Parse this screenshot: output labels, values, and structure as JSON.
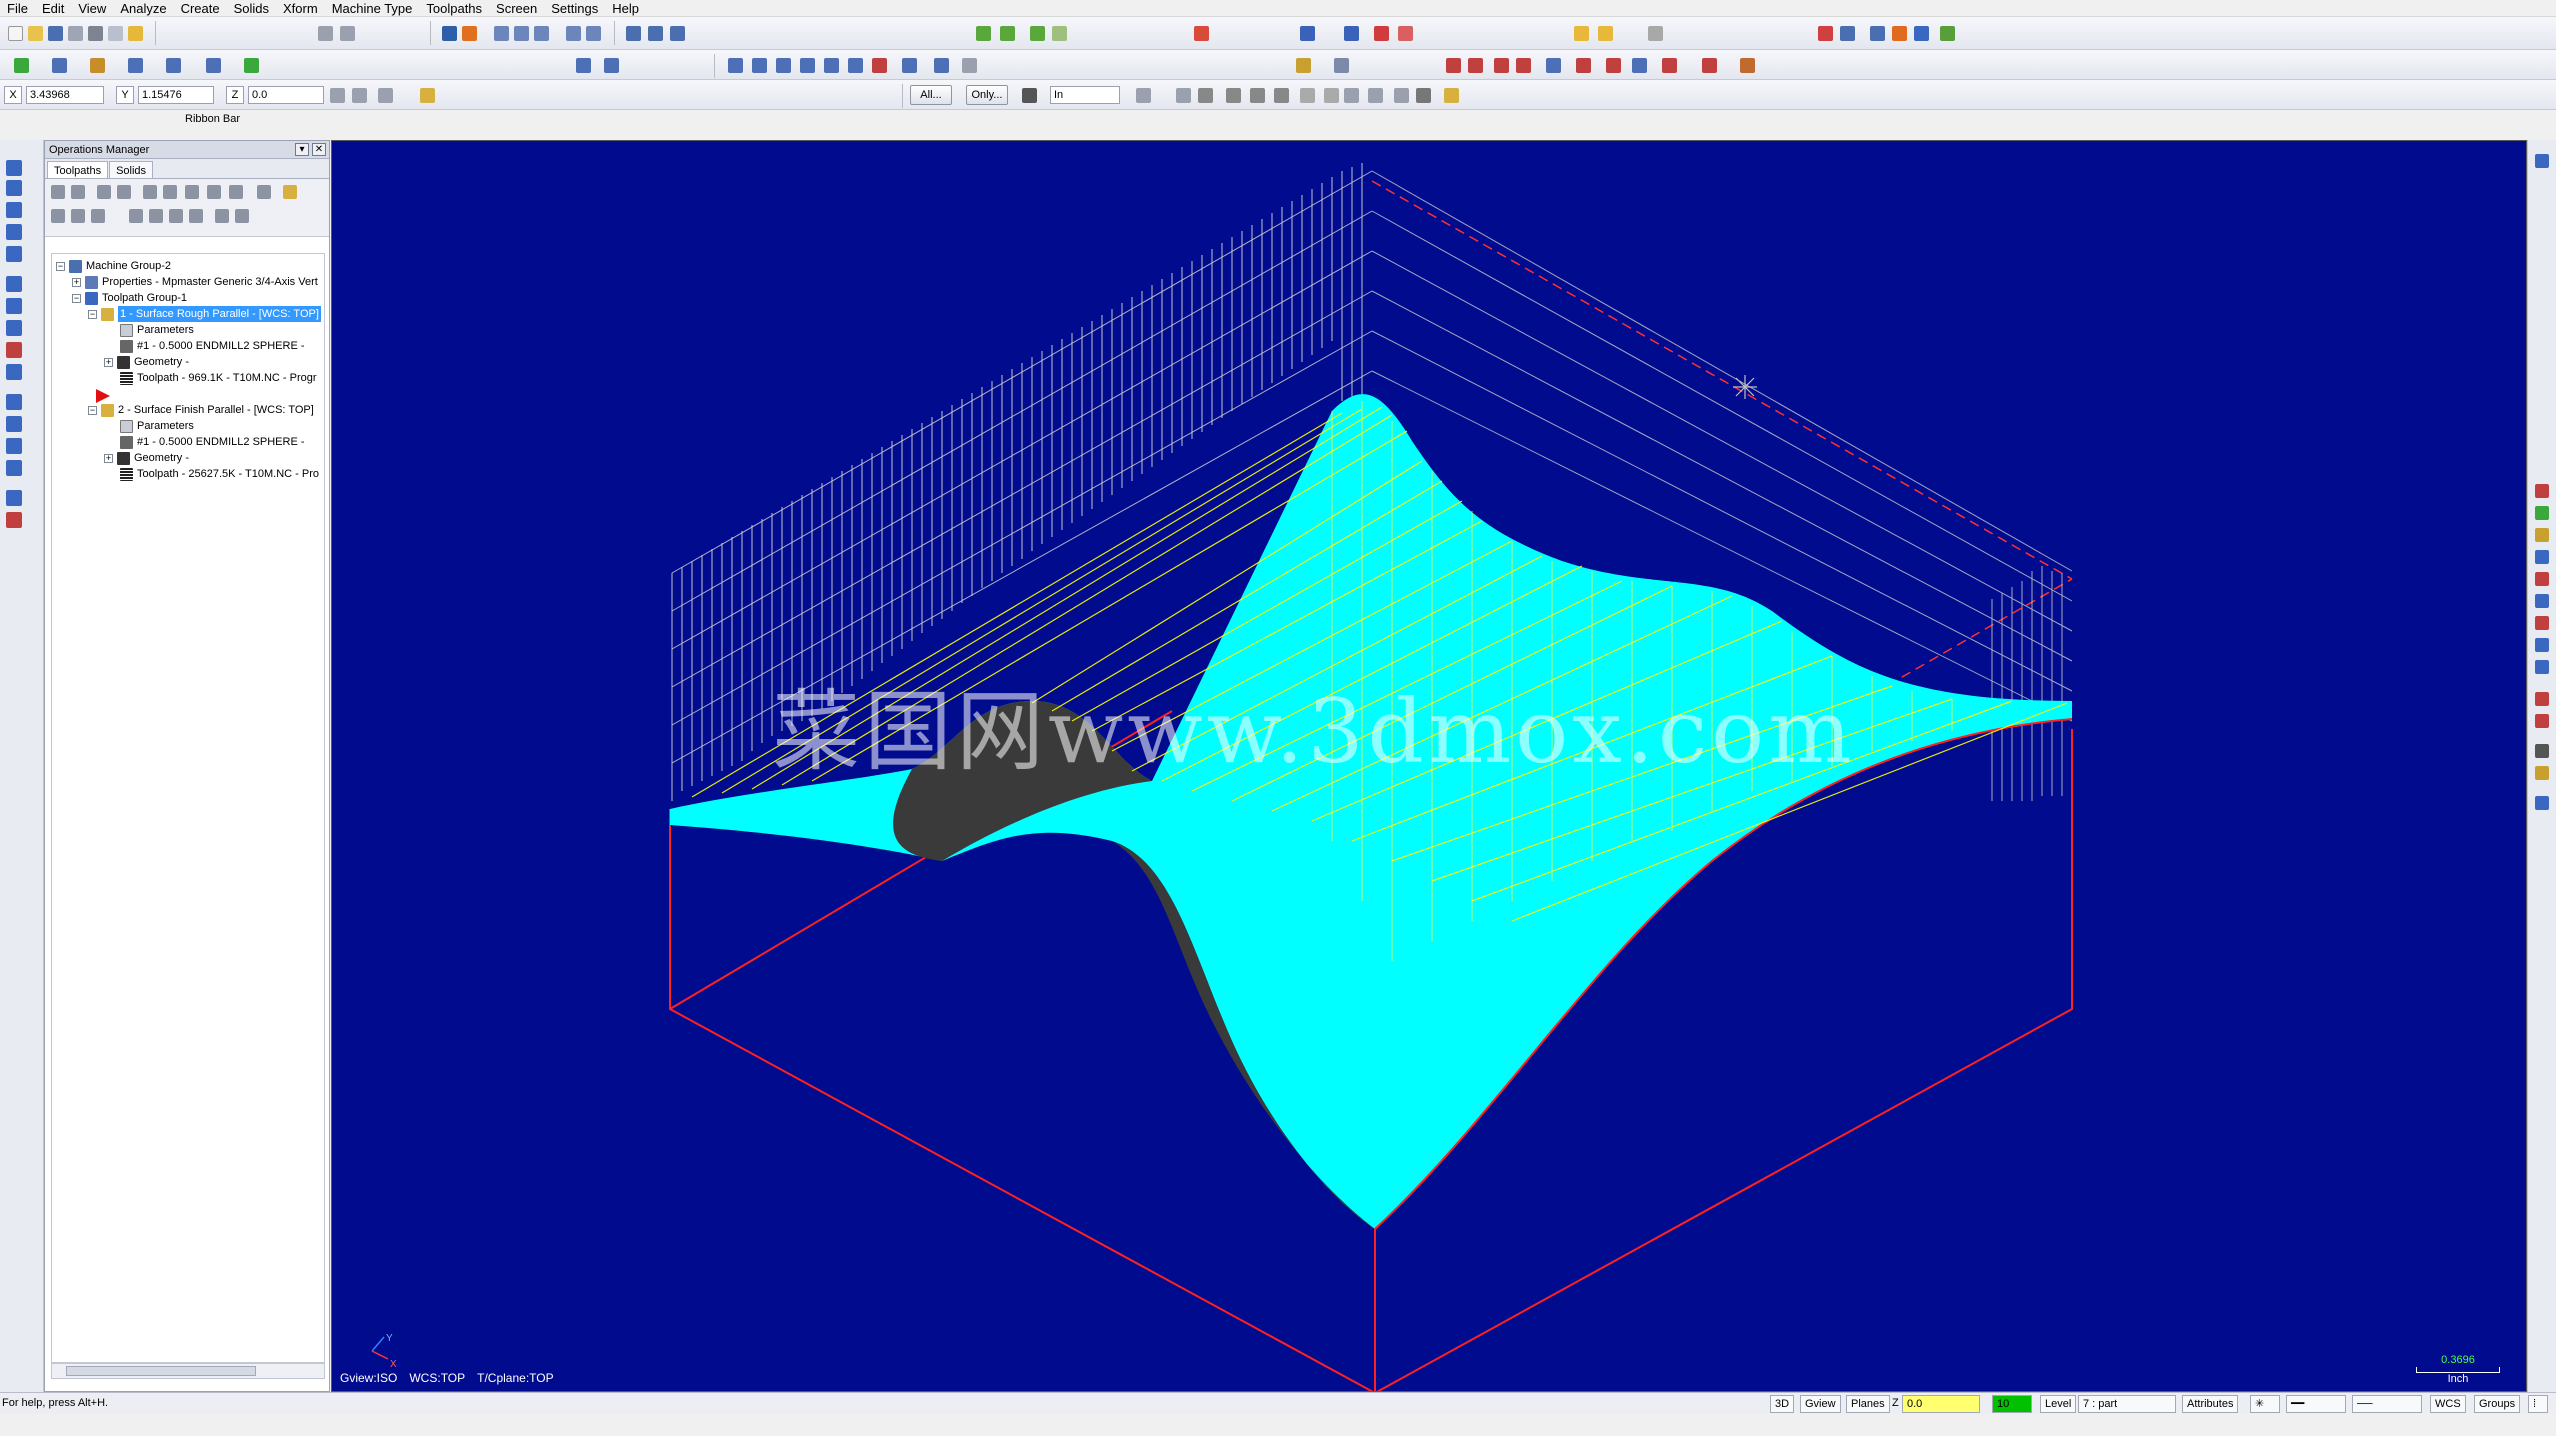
{
  "menu": [
    "File",
    "Edit",
    "View",
    "Analyze",
    "Create",
    "Solids",
    "Xform",
    "Machine Type",
    "Toolpaths",
    "Screen",
    "Settings",
    "Help"
  ],
  "coords": {
    "x_label": "X",
    "x_value": "3.43968",
    "y_label": "Y",
    "y_value": "1.15476",
    "z_label": "Z",
    "z_value": "0.0"
  },
  "toolbar": {
    "all_label": "All...",
    "only_label": "Only...",
    "units_value": "In"
  },
  "ribbon_label": "Ribbon Bar",
  "ops_manager": {
    "title": "Operations Manager",
    "tabs": [
      "Toolpaths",
      "Solids"
    ],
    "tree": [
      "Machine Group-2",
      "Properties - Mpmaster Generic 3/4-Axis Vert",
      "Toolpath Group-1",
      "1 - Surface Rough Parallel - [WCS: TOP]",
      "Parameters",
      "#1 - 0.5000 ENDMILL2 SPHERE -",
      "Geometry -",
      "Toolpath - 969.1K - T10M.NC - Progr",
      "2 - Surface Finish Parallel - [WCS: TOP]",
      "Parameters",
      "#1 - 0.5000 ENDMILL2 SPHERE -",
      "Geometry -",
      "Toolpath - 25627.5K - T10M.NC - Pro"
    ]
  },
  "viewport": {
    "gview": "Gview:ISO",
    "wcs": "WCS:TOP",
    "tcplane": "T/Cplane:TOP",
    "scale_value": "0.3696",
    "scale_unit": "Inch",
    "watermark": "菜国网www.3dmox.com",
    "axis_y": "Y",
    "axis_x": "X",
    "bg_color": "#000b8e",
    "part_color": "#00ffff",
    "toolpath_color": "#ffff00",
    "stock_color": "#ff2020"
  },
  "status": {
    "help": "For help, press Alt+H.",
    "view_3d": "3D",
    "gview": "Gview",
    "planes": "Planes",
    "z_label": "Z",
    "z_value": "0.0",
    "color_value": "10",
    "level_label": "Level",
    "level_value": "7 : part",
    "attributes": "Attributes",
    "wcs": "WCS",
    "groups": "Groups"
  }
}
